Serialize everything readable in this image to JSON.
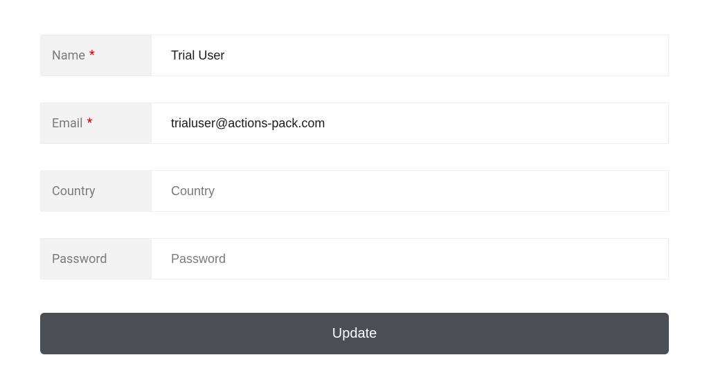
{
  "form": {
    "fields": {
      "name": {
        "label": "Name",
        "required": true,
        "value": "Trial User",
        "placeholder": ""
      },
      "email": {
        "label": "Email",
        "required": true,
        "value": "trialuser@actions-pack.com",
        "placeholder": ""
      },
      "country": {
        "label": "Country",
        "required": false,
        "value": "",
        "placeholder": "Country"
      },
      "password": {
        "label": "Password",
        "required": false,
        "value": "",
        "placeholder": "Password"
      }
    },
    "submit_label": "Update",
    "required_marker": "*"
  }
}
